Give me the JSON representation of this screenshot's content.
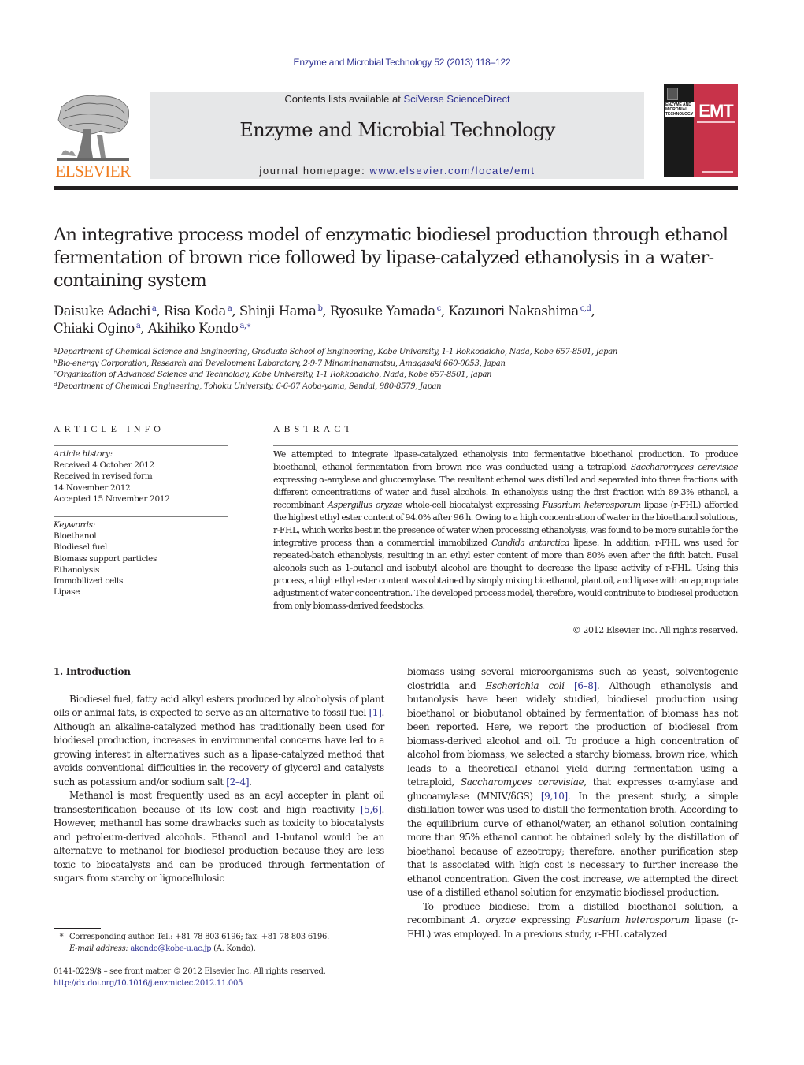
{
  "header": {
    "citation": "Enzyme and Microbial Technology 52 (2013) 118–122",
    "contents_prefix": "Contents lists available at ",
    "contents_link": "SciVerse ScienceDirect",
    "journal_name": "Enzyme and Microbial Technology",
    "homepage_prefix": "journal homepage: ",
    "homepage_link": "www.elsevier.com/locate/emt",
    "publisher_logo_text": "ELSEVIER",
    "cover": {
      "abbrev": "EMT",
      "title_lines": [
        "ENZYME AND",
        "MICROBIAL",
        "TECHNOLOGY"
      ]
    },
    "colors": {
      "link": "#2e3192",
      "elsevier_orange": "#f07d20",
      "banner_grey": "#e6e7e8",
      "cover_red": "#c8334a"
    }
  },
  "article": {
    "title": "An integrative process model of enzymatic biodiesel production through ethanol fermentation of brown rice followed by lipase-catalyzed ethanolysis in a water-containing system",
    "authors": [
      {
        "name": "Daisuke Adachi",
        "affil": "a"
      },
      {
        "name": "Risa Koda",
        "affil": "a"
      },
      {
        "name": "Shinji Hama",
        "affil": "b"
      },
      {
        "name": "Ryosuke Yamada",
        "affil": "c"
      },
      {
        "name": "Kazunori Nakashima",
        "affil": "c,d"
      },
      {
        "name": "Chiaki Ogino",
        "affil": "a"
      },
      {
        "name": "Akihiko Kondo",
        "affil": "a,∗"
      }
    ],
    "affiliations": [
      {
        "key": "a",
        "text": "Department of Chemical Science and Engineering, Graduate School of Engineering, Kobe University, 1-1 Rokkodaicho, Nada, Kobe 657-8501, Japan"
      },
      {
        "key": "b",
        "text": "Bio-energy Corporation, Research and Development Laboratory, 2-9-7 Minaminanamatsu, Amagasaki 660-0053, Japan"
      },
      {
        "key": "c",
        "text": "Organization of Advanced Science and Technology, Kobe University, 1-1 Rokkodaicho, Nada, Kobe 657-8501, Japan"
      },
      {
        "key": "d",
        "text": "Department of Chemical Engineering, Tohoku University, 6-6-07 Aoba-yama, Sendai, 980-8579, Japan"
      }
    ]
  },
  "article_info": {
    "heading": "ARTICLE INFO",
    "history_label": "Article history:",
    "history": [
      "Received 4 October 2012",
      "Received in revised form",
      "14 November 2012",
      "Accepted 15 November 2012"
    ],
    "keywords_label": "Keywords:",
    "keywords": [
      "Bioethanol",
      "Biodiesel fuel",
      "Biomass support particles",
      "Ethanolysis",
      "Immobilized cells",
      "Lipase"
    ]
  },
  "abstract": {
    "heading": "ABSTRACT",
    "segments": [
      {
        "t": "We attempted to integrate lipase-catalyzed ethanolysis into fermentative bioethanol production. To produce bioethanol, ethanol fermentation from brown rice was conducted using a tetraploid "
      },
      {
        "t": "Saccharomyces cerevisiae",
        "i": true
      },
      {
        "t": " expressing α-amylase and glucoamylase. The resultant ethanol was distilled and separated into three fractions with different concentrations of water and fusel alcohols. In ethanolysis using the first fraction with 89.3% ethanol, a recombinant "
      },
      {
        "t": "Aspergillus oryzae",
        "i": true
      },
      {
        "t": " whole-cell biocatalyst expressing "
      },
      {
        "t": "Fusarium heterosporum",
        "i": true
      },
      {
        "t": " lipase (r-FHL) afforded the highest ethyl ester content of 94.0% after 96 h. Owing to a high concentration of water in the bioethanol solutions, r-FHL, which works best in the presence of water when processing ethanolysis, was found to be more suitable for the integrative process than a commercial immobilized "
      },
      {
        "t": "Candida antarctica",
        "i": true
      },
      {
        "t": " lipase. In addition, r-FHL was used for repeated-batch ethanolysis, resulting in an ethyl ester content of more than 80% even after the fifth batch. Fusel alcohols such as 1-butanol and isobutyl alcohol are thought to decrease the lipase activity of r-FHL. Using this process, a high ethyl ester content was obtained by simply mixing bioethanol, plant oil, and lipase with an appropriate adjustment of water concentration. The developed process model, therefore, would contribute to biodiesel production from only biomass-derived feedstocks."
      }
    ],
    "copyright": "© 2012 Elsevier Inc. All rights reserved."
  },
  "body": {
    "section_title": "1.  Introduction",
    "left_paragraphs": [
      [
        {
          "t": "Biodiesel fuel, fatty acid alkyl esters produced by alcoholysis of plant oils or animal fats, is expected to serve as an alternative to fossil fuel "
        },
        {
          "t": "[1]",
          "c": true
        },
        {
          "t": ". Although an alkaline-catalyzed method has traditionally been used for biodiesel production, increases in environmental concerns have led to a growing interest in alternatives such as a lipase-catalyzed method that avoids conventional difficulties in the recovery of glycerol and catalysts such as potassium and/or sodium salt "
        },
        {
          "t": "[2–4]",
          "c": true
        },
        {
          "t": "."
        }
      ],
      [
        {
          "t": "Methanol is most frequently used as an acyl accepter in plant oil transesterification because of its low cost and high reactivity "
        },
        {
          "t": "[5,6]",
          "c": true
        },
        {
          "t": ". However, methanol has some drawbacks such as toxicity to biocatalysts and petroleum-derived alcohols. Ethanol and 1-butanol would be an alternative to methanol for biodiesel production because they are less toxic to biocatalysts and can be produced through fermentation of sugars from starchy or lignocellulosic"
        }
      ]
    ],
    "right_paragraphs": [
      [
        {
          "t": "biomass using several microorganisms such as yeast, solventogenic clostridia and "
        },
        {
          "t": "Escherichia coli",
          "i": true
        },
        {
          "t": " "
        },
        {
          "t": "[6–8]",
          "c": true
        },
        {
          "t": ". Although ethanolysis and butanolysis have been widely studied, biodiesel production using bioethanol or biobutanol obtained by fermentation of biomass has not been reported. Here, we report the production of biodiesel from biomass-derived alcohol and oil. To produce a high concentration of alcohol from biomass, we selected a starchy biomass, brown rice, which leads to a theoretical ethanol yield during fermentation using a tetraploid, "
        },
        {
          "t": "Saccharomyces cerevisiae",
          "i": true
        },
        {
          "t": ", that expresses α-amylase and glucoamylase (MNIV/δGS) "
        },
        {
          "t": "[9,10]",
          "c": true
        },
        {
          "t": ". In the present study, a simple distillation tower was used to distill the fermentation broth. According to the equilibrium curve of ethanol/water, an ethanol solution containing more than 95% ethanol cannot be obtained solely by the distillation of bioethanol because of azeotropy; therefore, another purification step that is associated with high cost is necessary to further increase the ethanol concentration. Given the cost increase, we attempted the direct use of a distilled ethanol solution for enzymatic biodiesel production."
        }
      ],
      [
        {
          "t": "To produce biodiesel from a distilled bioethanol solution, a recombinant "
        },
        {
          "t": "A. oryzae",
          "i": true
        },
        {
          "t": " expressing "
        },
        {
          "t": "Fusarium heterosporum",
          "i": true
        },
        {
          "t": " lipase (r-FHL) was employed. In a previous study, r-FHL catalyzed"
        }
      ]
    ]
  },
  "footer": {
    "corresponding_star": "*",
    "corresponding": "Corresponding author. Tel.: +81 78 803 6196; fax: +81 78 803 6196.",
    "email_label": "E-mail address:",
    "email": "akondo@kobe-u.ac.jp",
    "email_suffix": " (A. Kondo).",
    "issn": "0141-0229/$ – see front matter © 2012 Elsevier Inc. All rights reserved.",
    "doi": "http://dx.doi.org/10.1016/j.enzmictec.2012.11.005"
  }
}
